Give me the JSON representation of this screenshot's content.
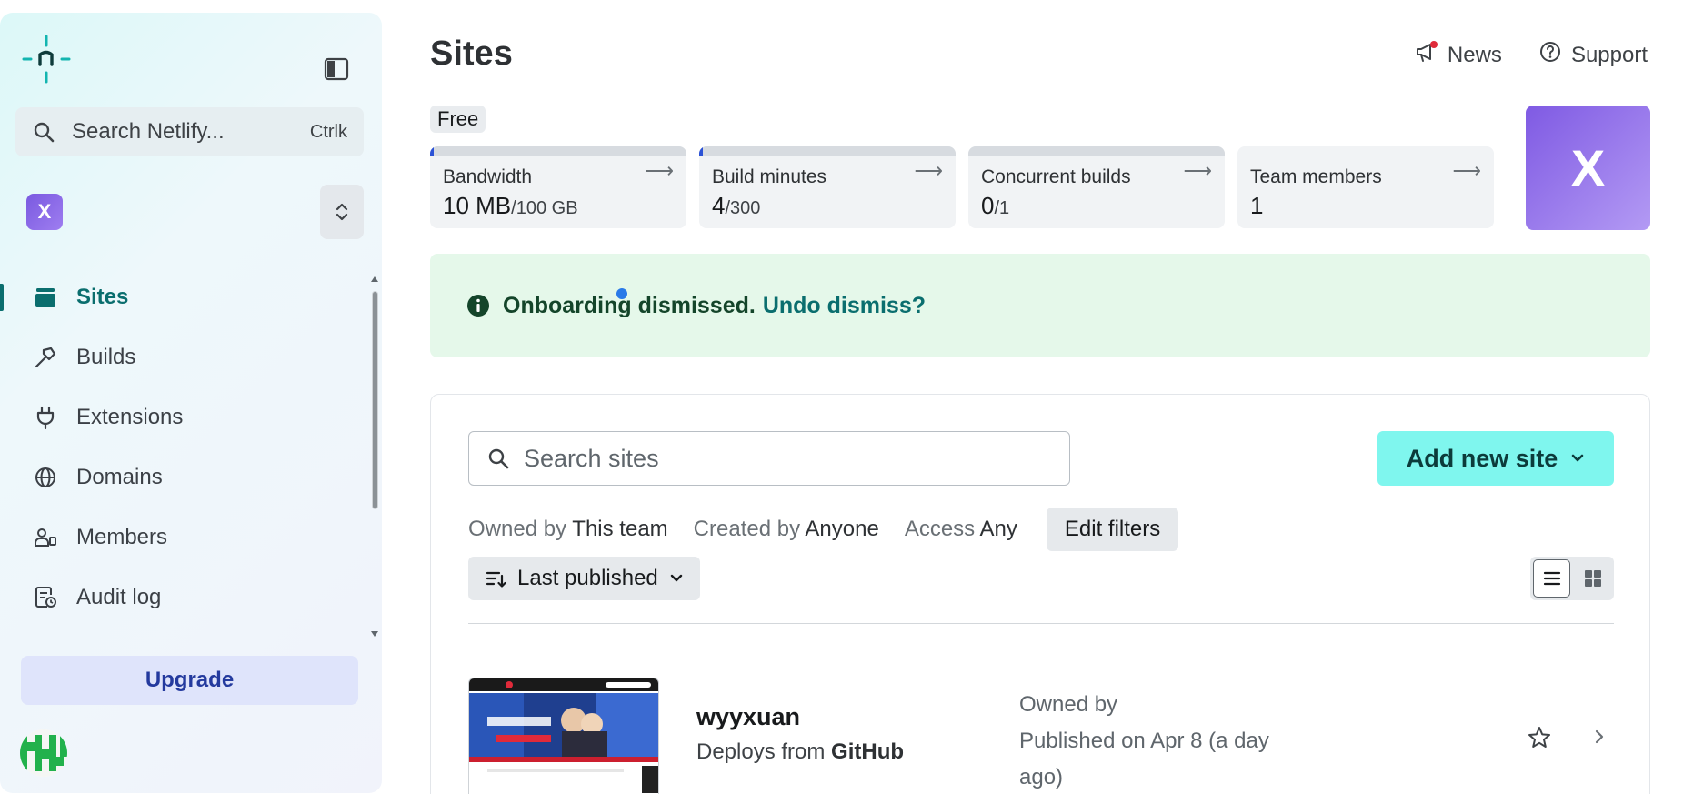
{
  "sidebar": {
    "search_placeholder": "Search Netlify...",
    "search_shortcut": "Ctrlk",
    "team_initial": "X",
    "nav": [
      {
        "label": "Sites",
        "icon": "layers-icon",
        "active": true
      },
      {
        "label": "Builds",
        "icon": "hammer-icon"
      },
      {
        "label": "Extensions",
        "icon": "plug-icon"
      },
      {
        "label": "Domains",
        "icon": "globe-icon"
      },
      {
        "label": "Members",
        "icon": "members-icon"
      },
      {
        "label": "Audit log",
        "icon": "audit-log-icon"
      }
    ],
    "upgrade_label": "Upgrade"
  },
  "header": {
    "title": "Sites",
    "news_label": "News",
    "support_label": "Support"
  },
  "plan": {
    "badge": "Free"
  },
  "usage": [
    {
      "label": "Bandwidth",
      "value": "10 MB",
      "limit": "/100 GB",
      "fraction": 0.0001
    },
    {
      "label": "Build minutes",
      "value": "4",
      "limit": "/300",
      "fraction": 0.013
    },
    {
      "label": "Concurrent builds",
      "value": "0",
      "limit": "/1",
      "fraction": 0
    },
    {
      "label": "Team members",
      "value": "1",
      "limit": "",
      "fraction": 0
    }
  ],
  "team_avatar_initial": "X",
  "onboarding": {
    "message": "Onboarding dismissed.",
    "undo_label": "Undo dismiss?"
  },
  "sites": {
    "search_placeholder": "Search sites",
    "add_button_label": "Add new site",
    "filters": {
      "owned_by_prefix": "Owned by",
      "owned_by_value": "This team",
      "created_by_prefix": "Created by",
      "created_by_value": "Anyone",
      "access_prefix": "Access",
      "access_value": "Any",
      "edit_label": "Edit filters"
    },
    "sort_label": "Last published",
    "list": [
      {
        "name": "wyyxuan",
        "deploy_prefix": "Deploys from",
        "deploy_source": "GitHub",
        "owned_by": "Owned by",
        "published": "Published on Apr 8 (a day ago)"
      }
    ]
  },
  "colors": {
    "accent": "#0a6e6e",
    "add_button": "#7ff6ee",
    "upgrade_bg": "#dfe4fb",
    "avatar_purple": "#7f5ae3",
    "onboarding_bg": "#e5f8ea"
  }
}
